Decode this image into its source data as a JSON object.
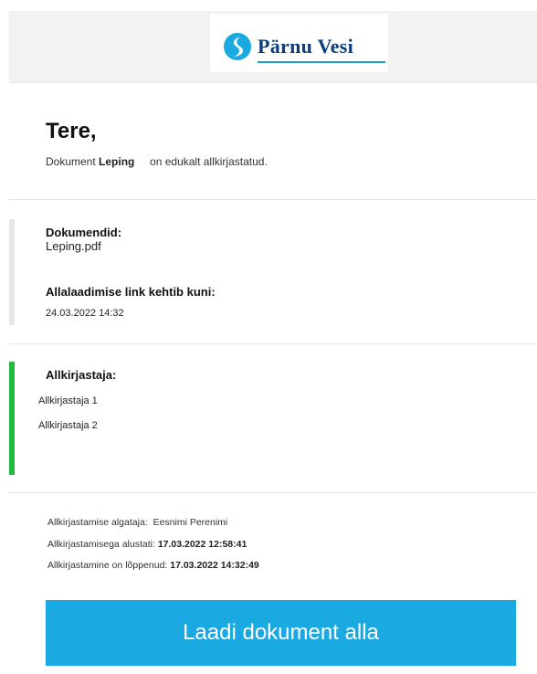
{
  "brand": {
    "name": "Pärnu Vesi",
    "accent": "#1ba9e1",
    "status_green": "#22bb3f"
  },
  "greeting": {
    "title": "Tere,",
    "prefix": "Dokument",
    "document_name": "Leping",
    "suffix": "on edukalt allkirjastatud."
  },
  "documents": {
    "label": "Dokumendid:",
    "file": "Leping.pdf",
    "expiry_label": "Allalaadimise link kehtib kuni:",
    "expiry_value": "24.03.2022 14:32"
  },
  "signers": {
    "label": "Allkirjastaja:",
    "items": [
      "Allkirjastaja 1",
      "Allkirjastaja 2"
    ]
  },
  "meta": {
    "initiator_label": "Allkirjastamise algataja:",
    "initiator_value": "Eesnimi Perenimi",
    "started_label": "Allkirjastamisega alustati:",
    "started_value": "17.03.2022 12:58:41",
    "ended_label": "Allkirjastamine on lõppenud:",
    "ended_value": "17.03.2022 14:32:49"
  },
  "download_button": {
    "label": "Laadi dokument alla"
  }
}
